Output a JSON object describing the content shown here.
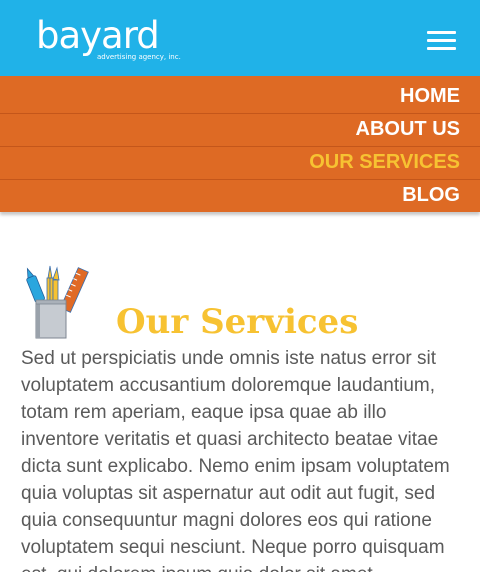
{
  "header": {
    "logo_text": "bayard",
    "logo_tagline": "advertising agency, inc.",
    "menu_icon": "hamburger-menu-icon",
    "background_color": "#20b2e8"
  },
  "nav": {
    "background_color": "#de6a24",
    "active_color": "#f7c232",
    "items": [
      {
        "label": "HOME",
        "active": false
      },
      {
        "label": "ABOUT US",
        "active": false
      },
      {
        "label": "OUR SERVICES",
        "active": true
      },
      {
        "label": "BLOG",
        "active": false
      }
    ]
  },
  "main": {
    "icon": "pencil-cup-icon",
    "title": "Our Services",
    "body": "Sed ut perspiciatis unde omnis iste natus error sit voluptatem accusantium doloremque laudantium, totam rem aperiam, eaque ipsa quae ab illo inventore veritatis et quasi architecto beatae vitae dicta sunt explicabo. Nemo enim ipsam voluptatem quia voluptas sit aspernatur aut odit aut fugit, sed quia consequuntur magni dolores eos qui ratione voluptatem sequi nesciunt. Neque porro quisquam est, qui dolorem ipsum quia dolor sit amet"
  }
}
